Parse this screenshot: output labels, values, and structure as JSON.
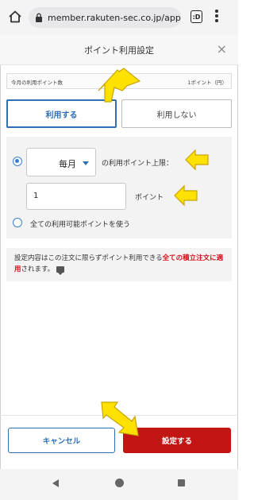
{
  "browser": {
    "url": "member.rakuten-sec.co.jp/app/",
    "tab_count": ":D",
    "icons": [
      "home-icon",
      "lock-icon",
      "tab-switcher-icon",
      "more-menu-icon"
    ]
  },
  "modal": {
    "title": "ポイント利用設定",
    "close_glyph": "×"
  },
  "info": {
    "label": "今月の利用ポイント数",
    "value": "1ポイント（円）"
  },
  "toggle": {
    "use_label": "利用する",
    "no_use_label": "利用しない",
    "selected": "use"
  },
  "settings": {
    "frequency_value": "毎月",
    "cap_label": "の利用ポイント上限：",
    "points_value": "1",
    "points_unit": "ポイント",
    "use_all_label": "全ての利用可能ポイントを使う",
    "selected_option": "monthly-cap"
  },
  "note": {
    "text_before": "設定内容はこの注文に限らずポイント利用できる",
    "text_highlight": "全ての積立注文に適用",
    "text_after": "されます。"
  },
  "footer": {
    "cancel_label": "キャンセル",
    "save_label": "設定する"
  },
  "colors": {
    "accent_blue": "#2f6fb5",
    "save_red": "#c41515",
    "arrow_yellow": "#ffe100",
    "highlight_red": "#d4101a"
  }
}
